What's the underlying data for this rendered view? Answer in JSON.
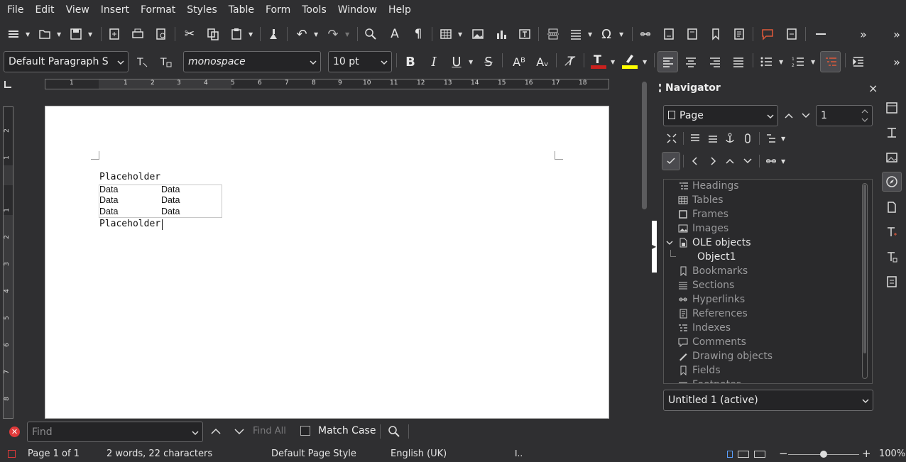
{
  "menu": [
    "File",
    "Edit",
    "View",
    "Insert",
    "Format",
    "Styles",
    "Table",
    "Form",
    "Tools",
    "Window",
    "Help"
  ],
  "formatting": {
    "paragraph_style": "Default Paragraph S",
    "font_name": "monospace",
    "font_size": "10 pt"
  },
  "ruler": {
    "h_numbers": [
      "1",
      "1",
      "2",
      "3",
      "4",
      "5",
      "6",
      "7",
      "8",
      "9",
      "10",
      "11",
      "12",
      "13",
      "14",
      "15",
      "16",
      "17",
      "18"
    ],
    "v_numbers": [
      "2",
      "1",
      "1",
      "1",
      "2",
      "3",
      "4",
      "5",
      "6",
      "7",
      "8"
    ]
  },
  "document": {
    "para1": "Placeholder",
    "para2": "Placeholder",
    "table": [
      [
        "Data",
        "Data"
      ],
      [
        "Data",
        "Data"
      ],
      [
        "Data",
        "Data"
      ]
    ]
  },
  "navigator": {
    "title": "Navigator",
    "close": "×",
    "navigate_by": "Page",
    "page_number": "1",
    "items": [
      {
        "label": "Headings",
        "icon": "headings-icon",
        "dim": true,
        "indent": 0
      },
      {
        "label": "Tables",
        "icon": "table-icon",
        "dim": true,
        "indent": 0
      },
      {
        "label": "Frames",
        "icon": "frame-icon",
        "dim": true,
        "indent": 0
      },
      {
        "label": "Images",
        "icon": "image-icon",
        "dim": true,
        "indent": 0
      },
      {
        "label": "OLE objects",
        "icon": "ole-icon",
        "dim": false,
        "indent": 0,
        "expanded": true
      },
      {
        "label": "Object1",
        "icon": "",
        "dim": false,
        "indent": 1
      },
      {
        "label": "Bookmarks",
        "icon": "bookmark-icon",
        "dim": true,
        "indent": 0
      },
      {
        "label": "Sections",
        "icon": "section-icon",
        "dim": true,
        "indent": 0
      },
      {
        "label": "Hyperlinks",
        "icon": "hyperlink-icon",
        "dim": true,
        "indent": 0
      },
      {
        "label": "References",
        "icon": "reference-icon",
        "dim": true,
        "indent": 0
      },
      {
        "label": "Indexes",
        "icon": "index-icon",
        "dim": true,
        "indent": 0
      },
      {
        "label": "Comments",
        "icon": "comment-icon",
        "dim": true,
        "indent": 0
      },
      {
        "label": "Drawing objects",
        "icon": "drawing-icon",
        "dim": true,
        "indent": 0
      },
      {
        "label": "Fields",
        "icon": "field-icon",
        "dim": true,
        "indent": 0
      },
      {
        "label": "Footnotes",
        "icon": "footnote-icon",
        "dim": true,
        "indent": 0
      }
    ],
    "document": "Untitled 1 (active)"
  },
  "find": {
    "placeholder": "Find",
    "find_all": "Find All",
    "match_case": "Match Case"
  },
  "status": {
    "page": "Page 1 of 1",
    "words": "2 words, 22 characters",
    "page_style": "Default Page Style",
    "language": "English (UK)",
    "zoom": "100%"
  },
  "colors": {
    "font_color": "#c9211e",
    "highlight": "#ffff00",
    "active_button": "#4a4a4e"
  }
}
